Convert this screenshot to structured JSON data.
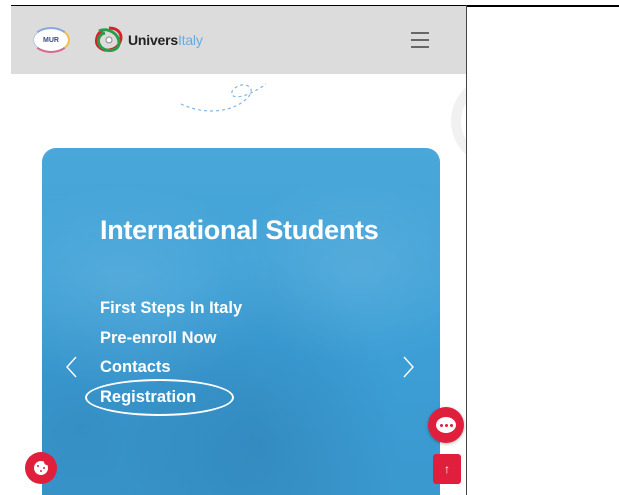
{
  "header": {
    "mur_logo_text": "MUR",
    "brand_name_prefix": "Univers",
    "brand_name_suffix": "Italy",
    "menu_icon": "hamburger-menu-icon"
  },
  "hero": {
    "title": "International Students",
    "links": [
      {
        "label": "First Steps In Italy"
      },
      {
        "label": "Pre-enroll Now"
      },
      {
        "label": "Contacts"
      },
      {
        "label": "Registration"
      }
    ],
    "prev_icon": "chevron-left-icon",
    "next_icon": "chevron-right-icon"
  },
  "floating": {
    "chat_icon": "chat-bubble-icon",
    "scroll_top_symbol": "↑",
    "cookie_icon": "cookie-icon"
  },
  "colors": {
    "header_bg": "#dcdcdc",
    "hero_blue": "#3c9fd6",
    "accent_red": "#e01f3d",
    "brand_accent": "#6aa9e0"
  }
}
